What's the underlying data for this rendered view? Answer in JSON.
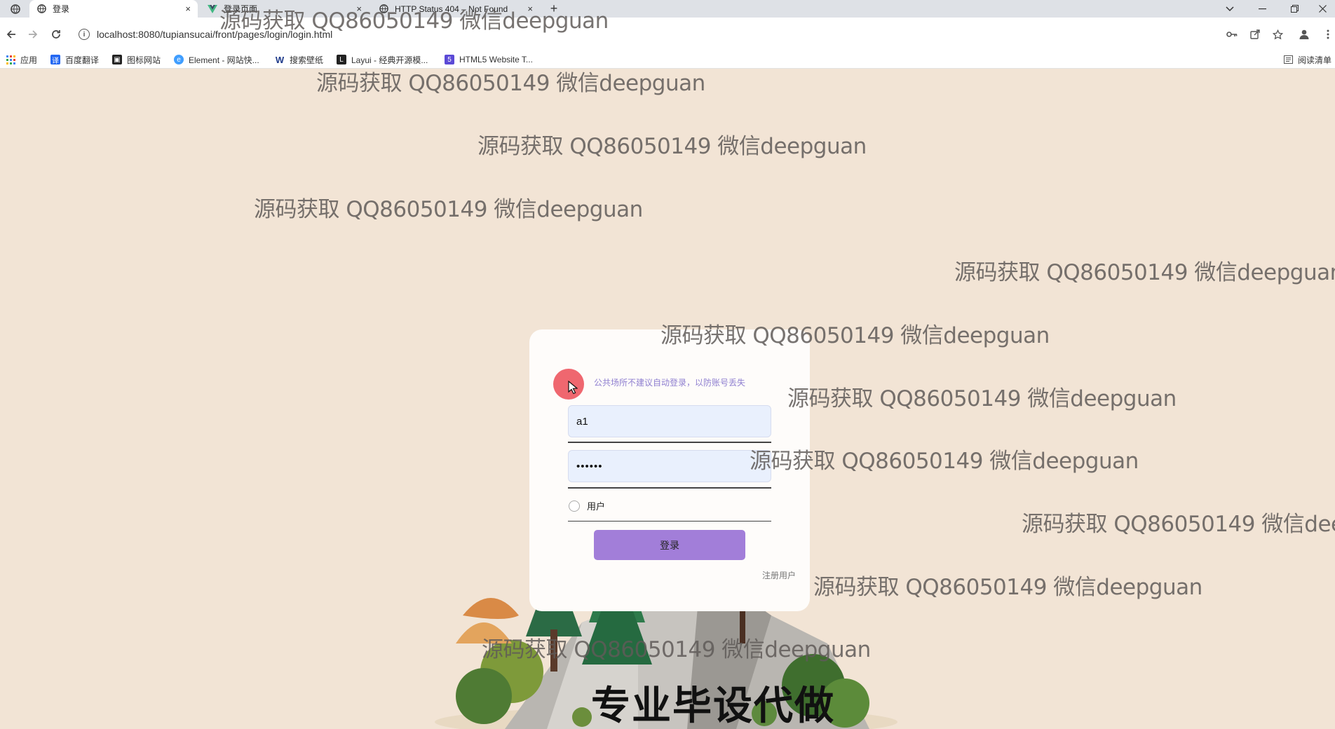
{
  "browser": {
    "tabs": [
      {
        "title": "登录",
        "close": "×"
      },
      {
        "title": "登录页面",
        "close": "×"
      },
      {
        "title": "HTTP Status 404 – Not Found",
        "close": "×"
      }
    ],
    "new_tab": "+",
    "url": "localhost:8080/tupiansucai/front/pages/login/login.html",
    "bookmarks": [
      {
        "label": "应用",
        "color": "#4285f4"
      },
      {
        "label": "百度翻译",
        "color": "#2468f2"
      },
      {
        "label": "图标网站",
        "color": "#222222"
      },
      {
        "label": "Element - 网站快...",
        "color": "#409eff"
      },
      {
        "label": "搜索壁纸",
        "color": "#1e3a8a"
      },
      {
        "label": "Layui - 经典开源模...",
        "color": "#222222"
      },
      {
        "label": "HTML5 Website T...",
        "color": "#5b4ad6"
      }
    ],
    "reading_list": "阅读清单"
  },
  "login": {
    "notice": "公共场所不建议自动登录，以防账号丢失",
    "username_value": "a1",
    "password_value": "••••••",
    "role_label": "用户",
    "login_button": "登录",
    "register_link": "注册用户"
  },
  "watermark": {
    "text": "源码获取 QQ86050149 微信deepguan"
  },
  "caption": "专业毕设代做"
}
